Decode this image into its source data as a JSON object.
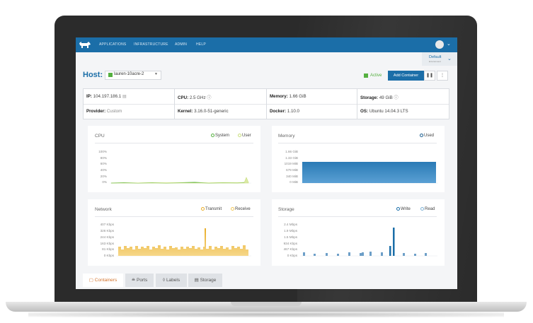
{
  "nav": {
    "items": [
      "APPLICATIONS",
      "INFRASTRUCTURE",
      "ADMIN",
      "HELP"
    ]
  },
  "environment": {
    "name": "Default",
    "sub": "Environment"
  },
  "host": {
    "label": "Host:",
    "name": "lauren-10acre-2",
    "status": "Active",
    "add_container": "Add Container"
  },
  "info": {
    "ip": {
      "label": "IP:",
      "value": "104.197.186.1"
    },
    "cpu": {
      "label": "CPU:",
      "value": "2.5 GHz"
    },
    "memory": {
      "label": "Memory:",
      "value": "1.66 GiB"
    },
    "storage": {
      "label": "Storage:",
      "value": "49 GiB"
    },
    "provider": {
      "label": "Provider:",
      "value": "Custom"
    },
    "kernel": {
      "label": "Kernel:",
      "value": "3.16.0-51-generic"
    },
    "docker": {
      "label": "Docker:",
      "value": "1.10.0"
    },
    "os": {
      "label": "OS:",
      "value": "Ubuntu 14.04.3 LTS"
    }
  },
  "panels": {
    "cpu": {
      "title": "CPU",
      "legend": [
        "System",
        "User"
      ],
      "ticks": [
        "100%",
        "80%",
        "60%",
        "40%",
        "20%",
        "0%"
      ]
    },
    "memory": {
      "title": "Memory",
      "legend": [
        "Used"
      ],
      "ticks": [
        "1.66 GiB",
        "1.33 GiB",
        "1019 MiB",
        "679 MiB",
        "340 MiB",
        "0 MiB"
      ]
    },
    "network": {
      "title": "Network",
      "legend": [
        "Transmit",
        "Receive"
      ],
      "ticks": [
        "407 Kbps",
        "326 Kbps",
        "244 Kbps",
        "163 Kbps",
        "81 Kbps",
        "0 Kbps"
      ]
    },
    "storage": {
      "title": "Storage",
      "legend": [
        "Write",
        "Read"
      ],
      "ticks": [
        "2.4 Mbps",
        "1.9 Mbps",
        "1.5 Mbps",
        "934 Kbps",
        "467 Kbps",
        "0 Kbps"
      ]
    }
  },
  "tabs": [
    "Containers",
    "Ports",
    "Labels",
    "Storage"
  ],
  "colors": {
    "brand": "#1b6ea8",
    "active": "#55b040",
    "cpu_system": "#55b040",
    "cpu_user": "#c8df7a",
    "memory": "#2a7ab5",
    "network": "#e9ae2a",
    "storage_write": "#1b6ea8",
    "storage_read": "#7fb3d6",
    "tab_selected": "#d3722a"
  }
}
